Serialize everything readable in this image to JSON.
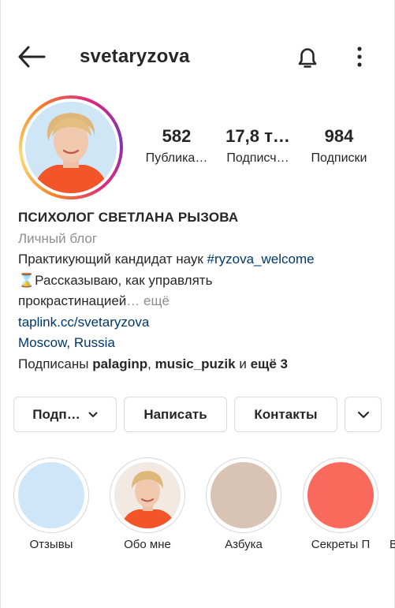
{
  "header": {
    "username": "svetaryzova"
  },
  "icons": {
    "back": "arrow-left-icon",
    "bell": "bell-icon",
    "more": "more-vertical-icon"
  },
  "stats": [
    {
      "value": "582",
      "label": "Публика…"
    },
    {
      "value": "17,8 т…",
      "label": "Подписч…"
    },
    {
      "value": "984",
      "label": "Подписки"
    }
  ],
  "bio": {
    "name": "ПСИХОЛОГ СВЕТЛАНА РЫЗОВА",
    "category": "Личный блог",
    "line1_text": "Практикующий кандидат наук ",
    "line1_tag": "#ryzova_welcome",
    "line2": "⌛Рассказываю, как управлять",
    "line3": "прокрастинацией",
    "more": "… ещё",
    "link": "taplink.cc/svetaryzova",
    "location": "Moscow, Russia",
    "followed_prefix": "Подписаны ",
    "followed_user1": "palaginp",
    "followed_sep": ", ",
    "followed_user2": "music_puzik",
    "followed_and": " и ",
    "followed_more": "ещё 3"
  },
  "buttons": {
    "follow": "Подп…",
    "message": "Написать",
    "contacts": "Контакты"
  },
  "highlights": [
    {
      "label": "Отзывы",
      "color": "#cfe6f8"
    },
    {
      "label": "Обо мне",
      "color": "#f3e9e3"
    },
    {
      "label": "Азбука",
      "color": "#d8c3b4"
    },
    {
      "label": "Секреты П",
      "color": "#f96a5c"
    },
    {
      "label": "В"
    }
  ],
  "colors": {
    "link": "#00376b",
    "secondary": "#8e8e8e",
    "border": "#dbdbdb"
  }
}
